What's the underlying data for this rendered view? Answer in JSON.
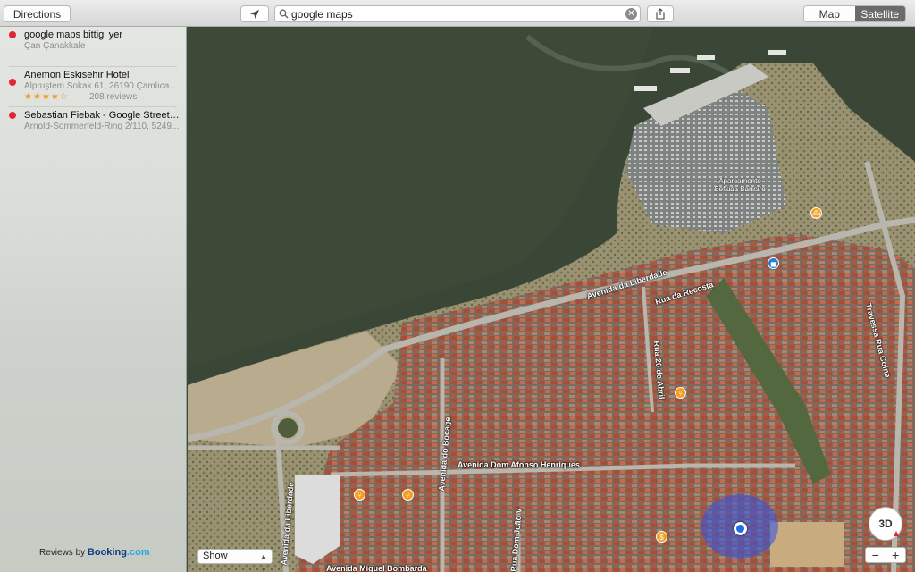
{
  "toolbar": {
    "directions_label": "Directions",
    "search_value": "google maps",
    "map_label": "Map",
    "satellite_label": "Satellite",
    "active_mode": "Satellite"
  },
  "sidebar": {
    "results": [
      {
        "title": "google maps bittigi yer",
        "subtitle": "Çan Çanakkale"
      },
      {
        "title": "Anemon Eskisehir Hotel",
        "subtitle": "Alpruştem Sokak 61, 26190 Çamlıca E...",
        "rating": 4.5,
        "stars": "★★★★☆",
        "reviews": "208 reviews"
      },
      {
        "title": "Sebastian Fiebak - Google Street Vie...",
        "subtitle": "Arnold-Sommerfeld-Ring 2/110, 5249..."
      }
    ],
    "booking_prefix": "Reviews by",
    "booking_brand": "Booking",
    "booking_suffix": ".com"
  },
  "map": {
    "roads": [
      "Avenida da Liberdade",
      "Rua da Recosta",
      "Travessa Rua Coina",
      "Rua 20 de Abril",
      "Avenida do Bocage",
      "Avenida Dom Afonso Henriques",
      "Avenida da Liberdade",
      "Rua Dom João V",
      "Avenida Miguel Bombarda"
    ],
    "poi_label": "Aparcamento\nSoflusa Barreiro",
    "show_label": "Show",
    "btn_3d": "3D",
    "zoom_out": "−",
    "zoom_in": "+"
  },
  "colors": {
    "pin": "#e2263a",
    "stars": "#f29c1f",
    "user_location": "#1d6fe8",
    "water": "#3b4736"
  }
}
